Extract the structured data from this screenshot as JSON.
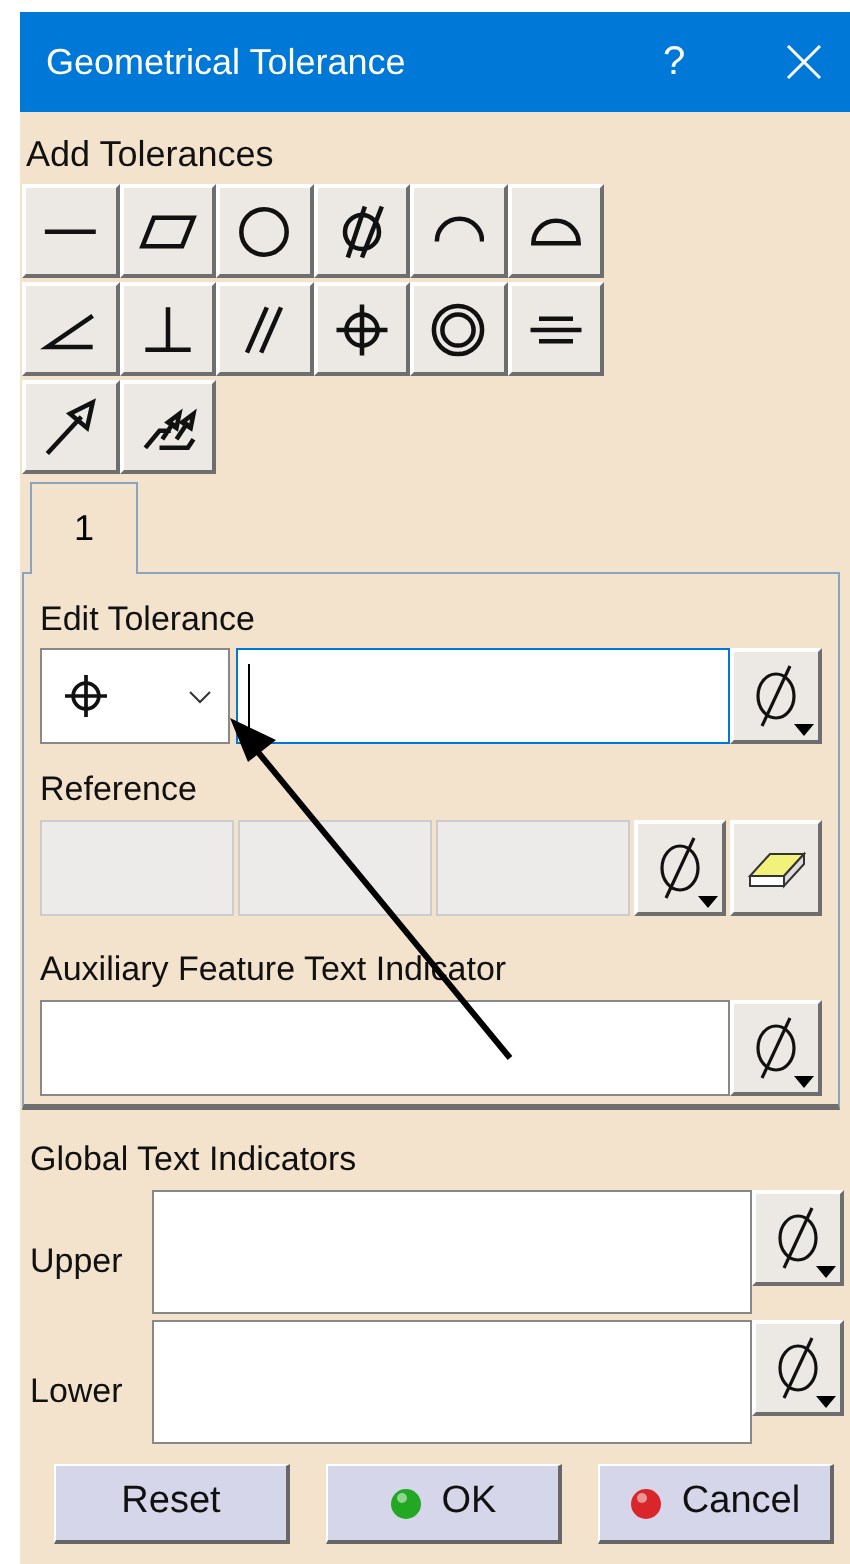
{
  "window": {
    "title": "Geometrical Tolerance",
    "help": "?"
  },
  "add_tolerances": {
    "label": "Add Tolerances",
    "buttons": [
      {
        "kind": "straightness"
      },
      {
        "kind": "flatness"
      },
      {
        "kind": "circularity"
      },
      {
        "kind": "cylindricity"
      },
      {
        "kind": "profile_line"
      },
      {
        "kind": "profile_surface"
      },
      {
        "kind": "angularity"
      },
      {
        "kind": "perpendicularity"
      },
      {
        "kind": "parallelism"
      },
      {
        "kind": "position"
      },
      {
        "kind": "concentricity"
      },
      {
        "kind": "symmetry"
      },
      {
        "kind": "circular_runout"
      },
      {
        "kind": "total_runout"
      }
    ]
  },
  "tabs": [
    {
      "label": "1",
      "selected": true
    }
  ],
  "edit_tolerance": {
    "label": "Edit Tolerance",
    "symbol": {
      "kind": "position"
    }
  },
  "reference": {
    "label": "Reference",
    "fields": [
      {
        "disabled": true
      },
      {
        "disabled": true
      },
      {
        "disabled": true
      }
    ]
  },
  "auxiliary": {
    "label": "Auxiliary Feature Text Indicator"
  },
  "global_text_indicators": {
    "label": "Global Text Indicators",
    "rows": [
      {
        "label": "Upper"
      },
      {
        "label": "Lower"
      }
    ]
  },
  "buttons": [
    {
      "label": "Reset",
      "kind": "plain"
    },
    {
      "label": "OK",
      "kind": "ok"
    },
    {
      "label": "Cancel",
      "kind": "cancel"
    }
  ]
}
